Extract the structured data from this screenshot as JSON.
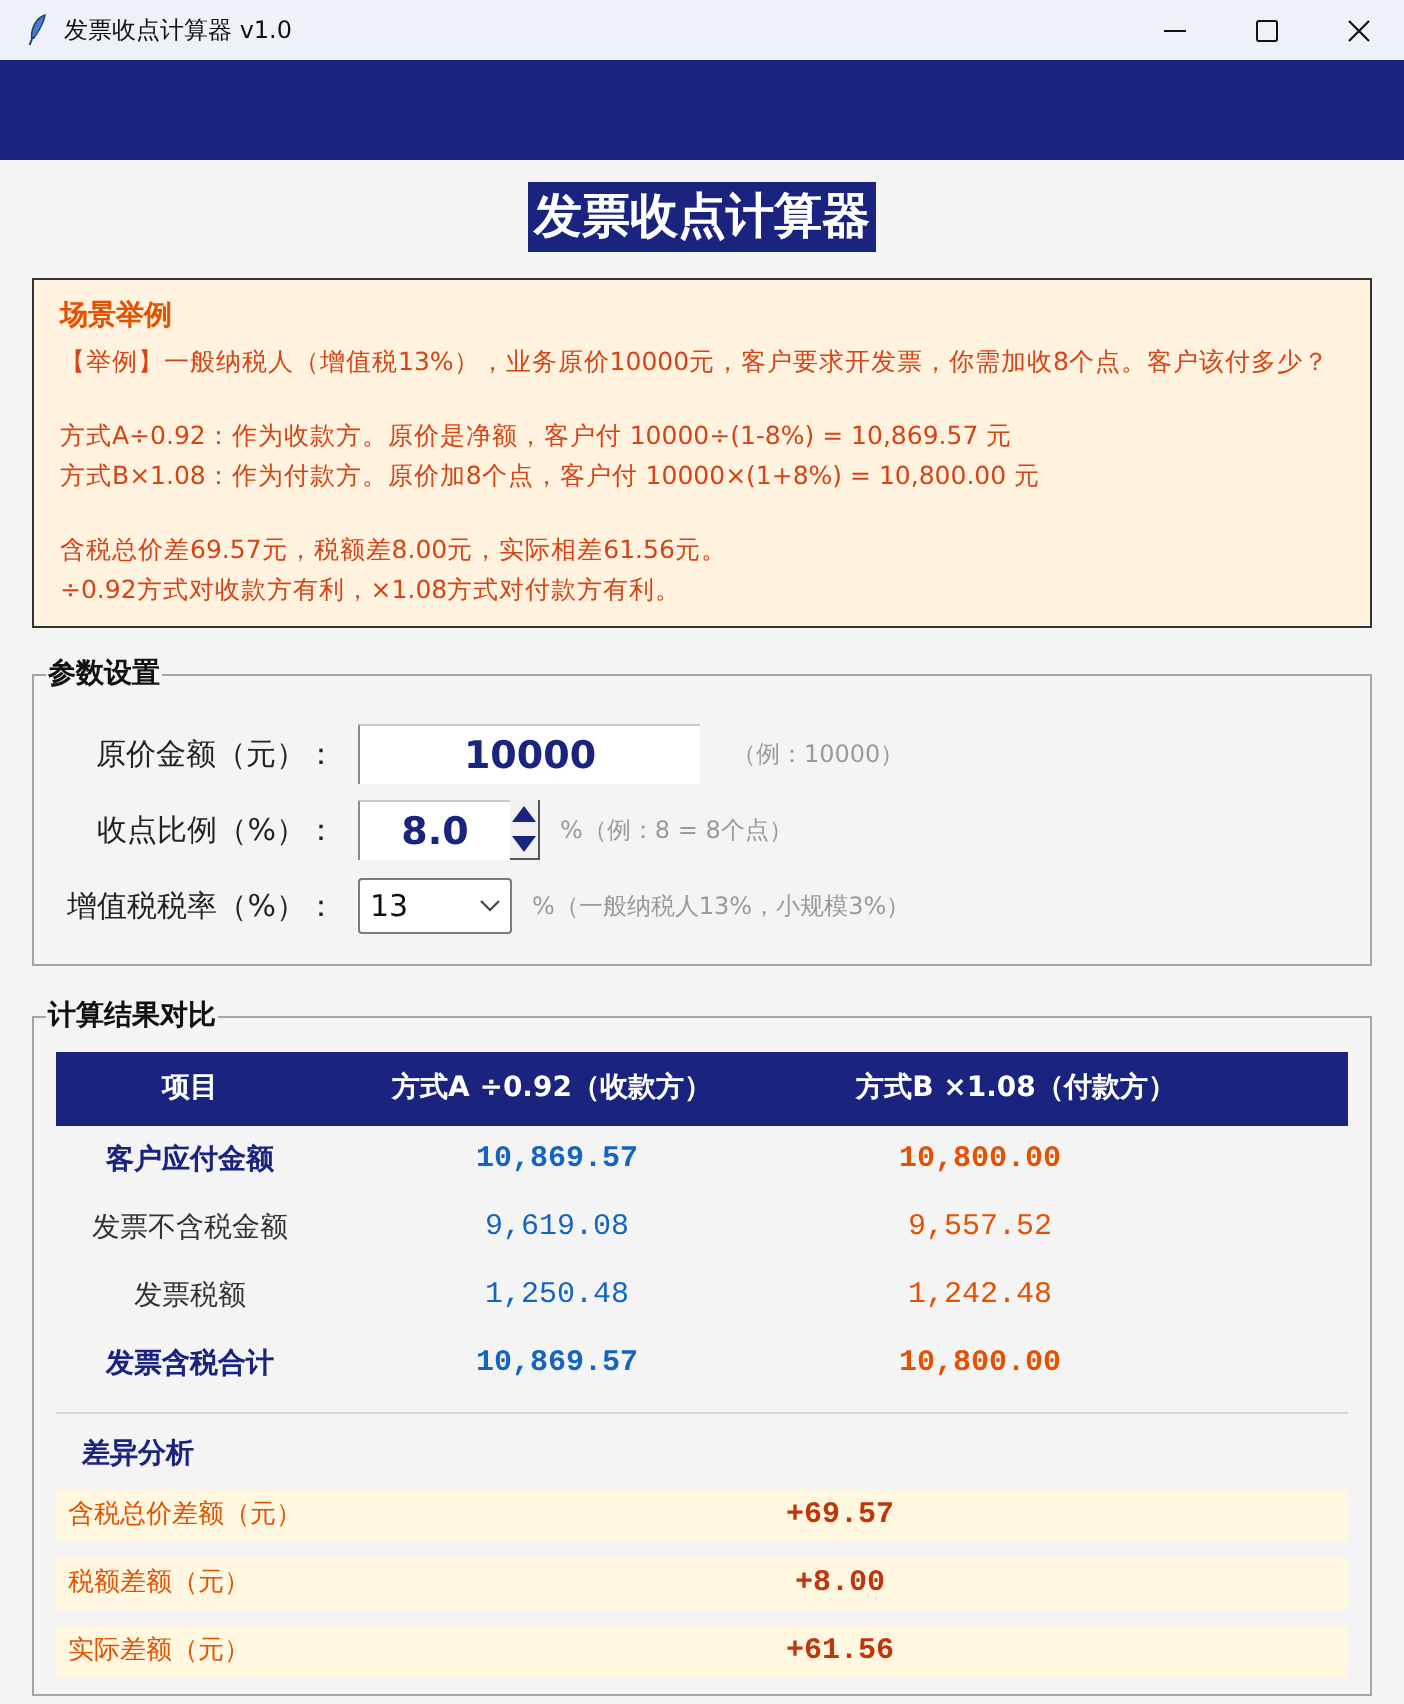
{
  "window": {
    "title": "发票收点计算器 v1.0"
  },
  "header": {
    "title": "发票收点计算器"
  },
  "scenario": {
    "heading": "场景举例",
    "paragraphs": [
      {
        "lines": [
          "【举例】一般纳税人（增值税13%），业务原价10000元，客户要求开发票，你需加收8个点。客户该付多少？"
        ]
      },
      {
        "lines": [
          "方式A÷0.92：作为收款方。原价是净额，客户付 10000÷(1-8%) = 10,869.57 元",
          "方式B×1.08：作为付款方。原价加8个点，客户付 10000×(1+8%) = 10,800.00 元"
        ]
      },
      {
        "lines": [
          "含税总价差69.57元，税额差8.00元，实际相差61.56元。",
          "÷0.92方式对收款方有利，×1.08方式对付款方有利。"
        ]
      }
    ]
  },
  "parameters": {
    "legend": "参数设置",
    "fields": [
      {
        "kind": "text",
        "label": "原价金额（元）：",
        "value": "10000",
        "hint": "（例：10000）"
      },
      {
        "kind": "spin",
        "label": "收点比例（%）：",
        "value": "8.0",
        "hint": "%（例：8 = 8个点）"
      },
      {
        "kind": "select",
        "label": "增值税税率（%）：",
        "value": "13",
        "hint": "%（一般纳税人13%，小规模3%）"
      }
    ]
  },
  "results": {
    "legend": "计算结果对比",
    "columns": [
      "项目",
      "方式A ÷0.92（收款方）",
      "方式B ×1.08（付款方）"
    ],
    "rows": [
      {
        "label": "客户应付金额",
        "emphasized": true,
        "a": "10,869.57",
        "b": "10,800.00"
      },
      {
        "label": "发票不含税金额",
        "emphasized": false,
        "a": "9,619.08",
        "b": "9,557.52"
      },
      {
        "label": "发票税额",
        "emphasized": false,
        "a": "1,250.48",
        "b": "1,242.48"
      },
      {
        "label": "发票含税合计",
        "emphasized": true,
        "a": "10,869.57",
        "b": "10,800.00"
      }
    ],
    "analysis": {
      "heading": "差异分析",
      "rows": [
        {
          "label": "含税总价差额（元）",
          "value": "+69.57"
        },
        {
          "label": "税额差额（元）",
          "value": "+8.00"
        },
        {
          "label": "实际差额（元）",
          "value": "+61.56"
        }
      ]
    }
  }
}
